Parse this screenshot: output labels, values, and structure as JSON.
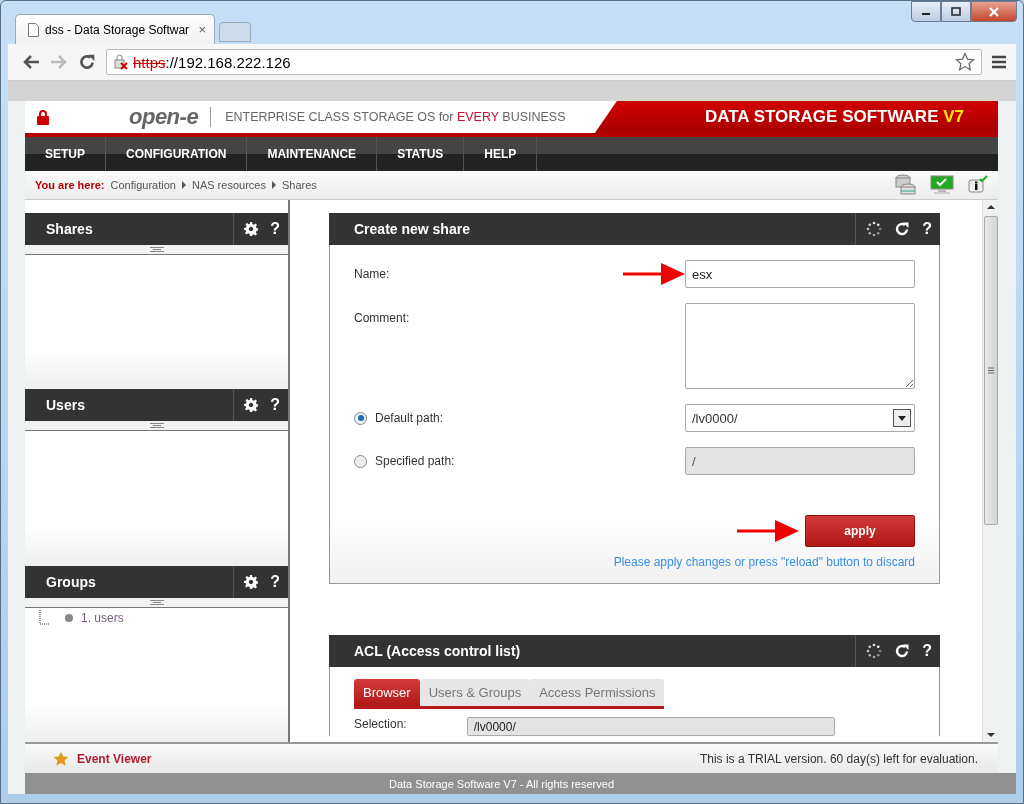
{
  "browser": {
    "tab_title": "dss - Data Storage Softwar",
    "tab_close": "×",
    "url_scheme": "https",
    "url_rest": "://192.168.222.126"
  },
  "header": {
    "logo": "open-e",
    "tagline": [
      {
        "text": "ENTERPRISE CLASS STORAGE OS for ",
        "highlight": false
      },
      {
        "text": "EVERY",
        "highlight": true
      },
      {
        "text": " BUSINESS",
        "highlight": false
      }
    ],
    "product": [
      {
        "text": "DATA STORAGE SOFTWARE ",
        "highlight": false
      },
      {
        "text": "V7",
        "highlight": true
      }
    ]
  },
  "nav": [
    {
      "label": "SETUP"
    },
    {
      "label": "CONFIGURATION"
    },
    {
      "label": "MAINTENANCE"
    },
    {
      "label": "STATUS"
    },
    {
      "label": "HELP"
    }
  ],
  "breadcrumb": {
    "label": "You are here:",
    "items": [
      "Configuration",
      "NAS resources",
      "Shares"
    ]
  },
  "sidebar": [
    {
      "title": "Shares",
      "help": "?"
    },
    {
      "title": "Users",
      "help": "?"
    },
    {
      "title": "Groups",
      "help": "?",
      "items": [
        {
          "label": "1. users"
        }
      ]
    }
  ],
  "create_share": {
    "title": "Create new share",
    "help": "?",
    "name_label": "Name:",
    "name_value": "esx",
    "comment_label": "Comment:",
    "paths": [
      {
        "label": "Default path:",
        "selected": true,
        "value": "/lv0000/",
        "kind": "dropdown",
        "disabled": false
      },
      {
        "label": "Specified path:",
        "selected": false,
        "value": "/",
        "kind": "text",
        "disabled": true
      }
    ],
    "apply": "apply",
    "hint": "Please apply changes or press \"reload\" button to discard"
  },
  "acl": {
    "title": "ACL (Access control list)",
    "help": "?",
    "tabs": [
      {
        "label": "Browser",
        "selected": true
      },
      {
        "label": "Users & Groups",
        "selected": false
      },
      {
        "label": "Access Permissions",
        "selected": false
      }
    ],
    "selection_label": "Selection:",
    "selection_value": "/lv0000/"
  },
  "status_bar": {
    "link": "Event Viewer",
    "trial": "This is a TRIAL version. 60 day(s) left for evaluation."
  },
  "footer": "Data Storage Software V7 - All rights reserved"
}
